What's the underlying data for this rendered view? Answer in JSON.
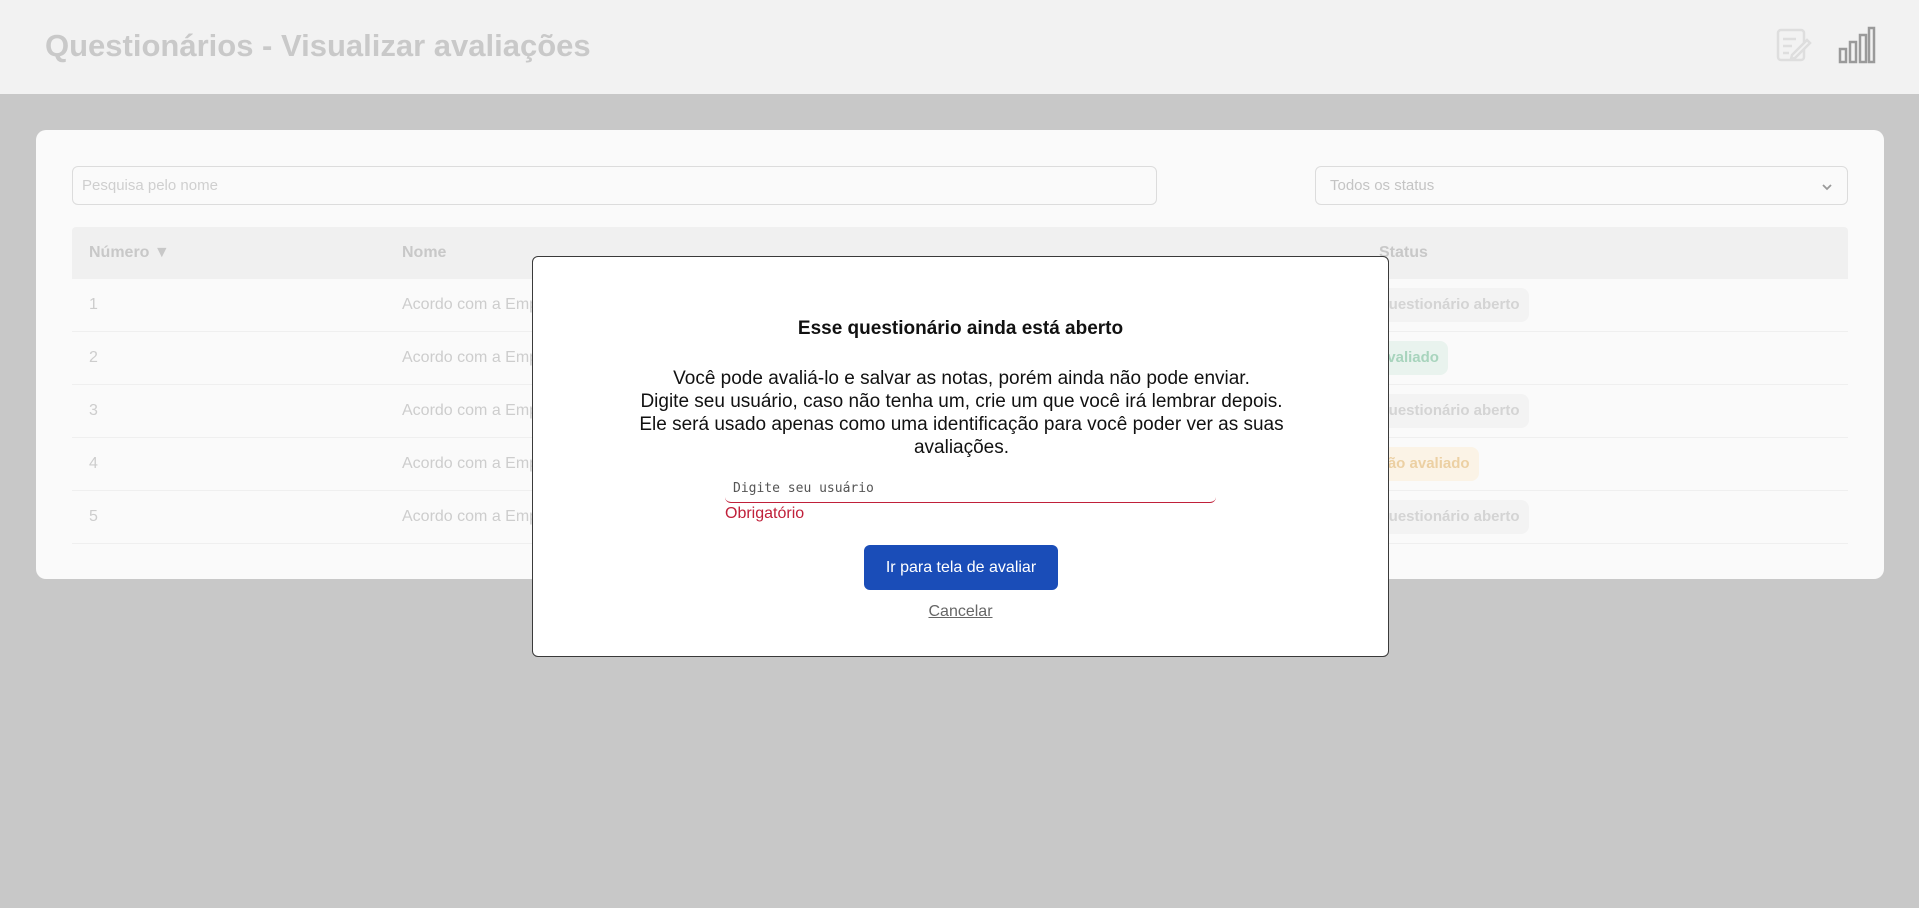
{
  "header": {
    "title": "Questionários - Visualizar avaliações",
    "icons": [
      "edit-icon",
      "bar-chart-icon"
    ]
  },
  "filters": {
    "search_placeholder": "Pesquisa pelo nome",
    "status_selected": "Todos os status"
  },
  "table": {
    "columns": [
      "Número ▼",
      "Nome",
      "Status"
    ],
    "rows": [
      {
        "numero": "1",
        "nome": "Acordo com a Emp",
        "status": "Questionário aberto"
      },
      {
        "numero": "2",
        "nome": "Acordo com a Emp",
        "status": "Avaliado"
      },
      {
        "numero": "3",
        "nome": "Acordo com a Emp",
        "status": "Questionário aberto"
      },
      {
        "numero": "4",
        "nome": "Acordo com a Emp",
        "status": "Não avaliado"
      },
      {
        "numero": "5",
        "nome": "Acordo com a Emp",
        "status": "Questionário aberto"
      }
    ]
  },
  "modal": {
    "title": "Esse questionário ainda está aberto",
    "text_lines": [
      "Você pode avaliá-lo e salvar as notas, porém ainda não pode enviar.",
      "Digite seu usuário, caso não tenha um, crie um que você irá lembrar depois.",
      "Ele será usado apenas como uma identificação para você poder ver as suas avaliações."
    ],
    "input_placeholder": "Digite seu usuário",
    "input_value": "",
    "error_text": "Obrigatório",
    "primary_button": "Ir para tela de avaliar",
    "cancel_link": "Cancelar"
  },
  "colors": {
    "primary": "#1a4db8",
    "error": "#c0203a",
    "overlay": "#c8c8c8"
  }
}
